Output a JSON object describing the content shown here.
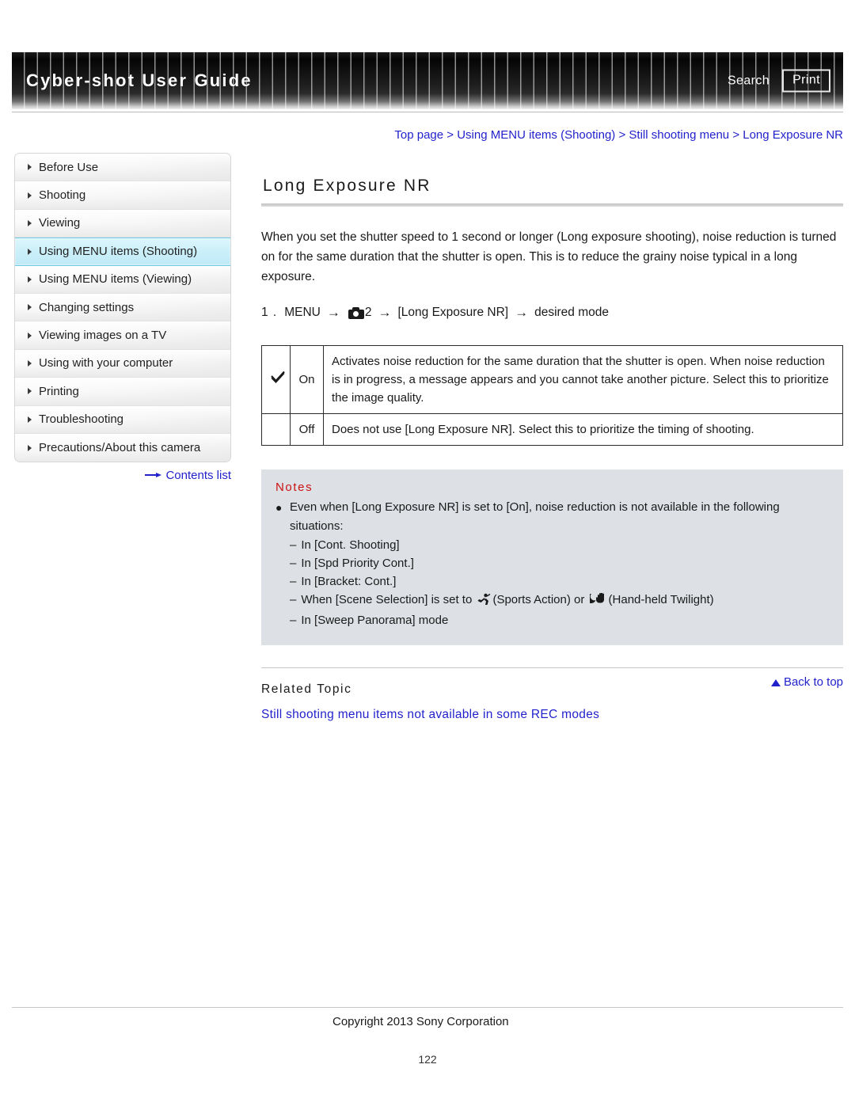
{
  "header": {
    "title": "Cyber-shot User Guide",
    "search_label": "Search",
    "print_label": "Print"
  },
  "breadcrumb": {
    "items": [
      "Top page",
      "Using MENU items (Shooting)",
      "Still shooting menu",
      "Long Exposure NR"
    ],
    "separator": ">"
  },
  "sidebar": {
    "items": [
      {
        "label": "Before Use",
        "active": false
      },
      {
        "label": "Shooting",
        "active": false
      },
      {
        "label": "Viewing",
        "active": false
      },
      {
        "label": "Using MENU items (Shooting)",
        "active": true
      },
      {
        "label": "Using MENU items (Viewing)",
        "active": false
      },
      {
        "label": "Changing settings",
        "active": false
      },
      {
        "label": "Viewing images on a TV",
        "active": false
      },
      {
        "label": "Using with your computer",
        "active": false
      },
      {
        "label": "Printing",
        "active": false
      },
      {
        "label": "Troubleshooting",
        "active": false
      },
      {
        "label": "Precautions/About this camera",
        "active": false
      }
    ],
    "contents_list_label": "Contents list"
  },
  "main": {
    "title": "Long Exposure NR",
    "intro": "When you set the shutter speed to 1 second or longer (Long exposure shooting), noise reduction is turned on for the same duration that the shutter is open. This is to reduce the grainy noise typical in a long exposure.",
    "step": {
      "number": "1 .",
      "menu_label": "MENU",
      "tab_number": "2",
      "item_label": "[Long Exposure NR]",
      "result_label": "desired mode",
      "arrow": "→"
    },
    "options_table": {
      "rows": [
        {
          "checked": true,
          "name": "On",
          "description": "Activates noise reduction for the same duration that the shutter is open. When noise reduction is in progress, a message appears and you cannot take another picture. Select this to prioritize the image quality."
        },
        {
          "checked": false,
          "name": "Off",
          "description": "Does not use [Long Exposure NR]. Select this to prioritize the timing of shooting."
        }
      ]
    },
    "notes": {
      "heading": "Notes",
      "bullet": "●",
      "items": [
        "Even when [Long Exposure NR] is set to [On], noise reduction is not available in the following situations:"
      ],
      "sub_items": [
        {
          "dash": "–",
          "text": "In [Cont. Shooting]"
        },
        {
          "dash": "–",
          "text": "In [Spd Priority Cont.]"
        },
        {
          "dash": "–",
          "text": "In [Bracket: Cont.]"
        },
        {
          "dash": "–",
          "text_before": "When [Scene Selection] is set to",
          "icon1_label": "(Sports Action)",
          "or_label": "or",
          "icon2_label": "(Hand-held Twilight)"
        },
        {
          "dash": "–",
          "text": "In [Sweep Panorama] mode"
        }
      ]
    },
    "related": {
      "heading": "Related Topic",
      "link": "Still shooting menu items not available in some REC modes"
    },
    "back_to_top": "Back to top"
  },
  "footer": {
    "copyright": "Copyright 2013 Sony Corporation",
    "page_number": "122"
  },
  "colors": {
    "link": "#2222cc",
    "notes_heading": "#cc1111",
    "notes_bg": "#dde1e6",
    "sidebar_active_bg": "#cbeff9",
    "sidebar_active_border": "#6fc9e4"
  }
}
